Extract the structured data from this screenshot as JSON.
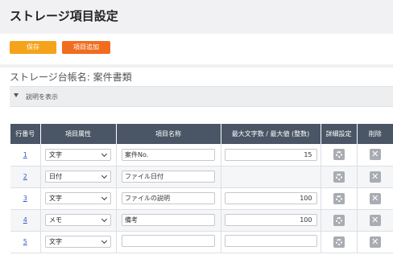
{
  "page": {
    "title": "ストレージ項目設定"
  },
  "toolbar": {
    "save_label": "保存",
    "add_label": "項目追加"
  },
  "ledger": {
    "title": "ストレージ台帳名: 案件書類"
  },
  "description": {
    "toggle_label": "説明を表示"
  },
  "table": {
    "headers": {
      "row_no": "行番号",
      "attribute": "項目属性",
      "name": "項目名称",
      "max": "最大文字数 / 最大値 (整数)",
      "detail": "詳細設定",
      "delete": "削除"
    },
    "rows": [
      {
        "no": "1",
        "attribute": "文字",
        "name": "案件No.",
        "max": "15"
      },
      {
        "no": "2",
        "attribute": "日付",
        "name": "ファイル日付",
        "max": ""
      },
      {
        "no": "3",
        "attribute": "文字",
        "name": "ファイルの説明",
        "max": "100"
      },
      {
        "no": "4",
        "attribute": "メモ",
        "name": "備考",
        "max": "100"
      },
      {
        "no": "5",
        "attribute": "文字",
        "name": "",
        "max": ""
      }
    ]
  },
  "icons": {
    "caret": "caret-down-icon",
    "detail": "gear-icon",
    "delete": "close-icon",
    "select": "chevron-down-icon"
  },
  "colors": {
    "save": "#f5a31a",
    "add": "#f06d1f",
    "header": "#4a5566",
    "link": "#3a58c4"
  }
}
